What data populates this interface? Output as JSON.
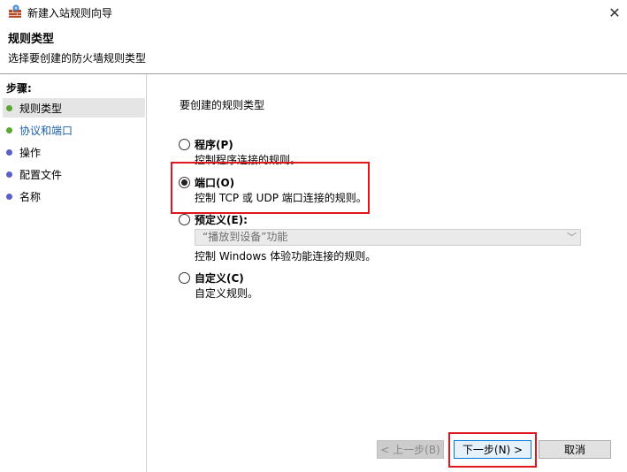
{
  "window": {
    "title": "新建入站规则向导",
    "close_glyph": "✕"
  },
  "header": {
    "title": "规则类型",
    "subtitle": "选择要创建的防火墙规则类型"
  },
  "steps": {
    "title": "步骤:",
    "items": [
      {
        "label": "规则类型",
        "dot_color": "#5aa832"
      },
      {
        "label": "协议和端口",
        "dot_color": "#5aa832"
      },
      {
        "label": "操作",
        "dot_color": "#5b5fc7"
      },
      {
        "label": "配置文件",
        "dot_color": "#5b5fc7"
      },
      {
        "label": "名称",
        "dot_color": "#5b5fc7"
      }
    ]
  },
  "main": {
    "prompt": "要创建的规则类型",
    "options": [
      {
        "label": "程序(P)",
        "desc": "控制程序连接的规则。",
        "checked": false
      },
      {
        "label": "端口(O)",
        "desc": "控制 TCP 或 UDP 端口连接的规则。",
        "checked": true
      },
      {
        "label": "预定义(E):",
        "desc": "控制 Windows 体验功能连接的规则。",
        "checked": false
      },
      {
        "label": "自定义(C)",
        "desc": "自定义规则。",
        "checked": false
      }
    ],
    "predefined_select_value": "“播放到设备”功能"
  },
  "buttons": {
    "back": "< 上一步(B)",
    "next": "下一步(N) >",
    "cancel": "取消"
  },
  "colors": {
    "highlight": "#e0161e",
    "link": "#1a5ea8"
  }
}
